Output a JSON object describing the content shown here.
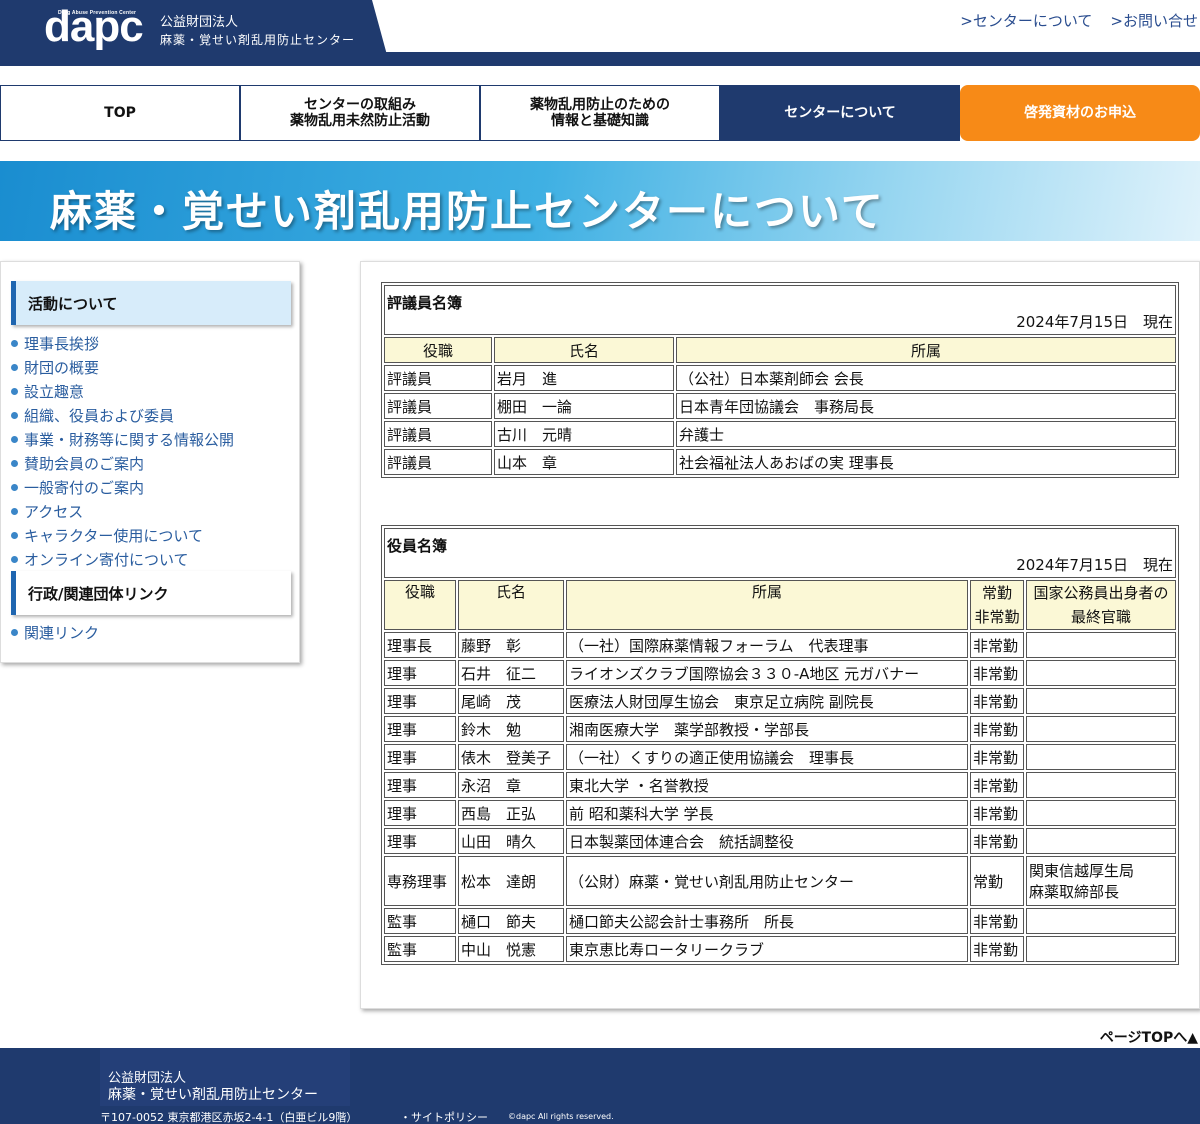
{
  "header": {
    "logo_small": "Drug Abuse Prevention Center",
    "logo_text": "dapc",
    "org_line1": "公益財団法人",
    "org_line2": "麻薬・覚せい剤乱用防止センター",
    "links": [
      ">センターについて",
      ">お問い合せ"
    ]
  },
  "nav": [
    {
      "label": "TOP"
    },
    {
      "label": "センターの取組み 薬物乱用未然防止活動"
    },
    {
      "label": "薬物乱用防止のための 情報と基礎知識"
    },
    {
      "label": "センターについて"
    },
    {
      "label": "啓発資材のお申込"
    }
  ],
  "banner": {
    "title": "麻薬・覚せい剤乱用防止センターについて"
  },
  "sidebar": {
    "section1": "活動について",
    "items": [
      "理事長挨拶",
      "財団の概要",
      "設立趣意",
      "組織、役員および委員",
      "事業・財務等に関する情報公開",
      "賛助会員のご案内",
      "一般寄付のご案内",
      "アクセス",
      "キャラクター使用について",
      "オンライン寄付について"
    ],
    "section2": "行政/関連団体リンク",
    "items2": [
      "関連リンク"
    ]
  },
  "councilors": {
    "title": "評議員名簿",
    "date": "2024年7月15日　現在",
    "headers": [
      "役職",
      "氏名",
      "所属"
    ],
    "rows": [
      [
        "評議員",
        "岩月　進",
        "（公社）日本薬剤師会 会長"
      ],
      [
        "評議員",
        "棚田　一論",
        "日本青年団協議会　事務局長"
      ],
      [
        "評議員",
        "古川　元晴",
        "弁護士"
      ],
      [
        "評議員",
        "山本　章",
        "社会福祉法人あおばの実 理事長"
      ]
    ]
  },
  "officers": {
    "title": "役員名簿",
    "date": "2024年7月15日　現在",
    "headers": [
      "役職",
      "氏名",
      "所属",
      "常勤",
      "非常勤",
      "国家公務員出身者の",
      "最終官職"
    ],
    "rows": [
      [
        "理事長",
        "藤野　彰",
        "（一社）国際麻薬情報フォーラム　代表理事",
        "非常勤",
        ""
      ],
      [
        "理事",
        "石井　征二",
        "ライオンズクラブ国際協会３３０-A地区 元ガバナー",
        "非常勤",
        ""
      ],
      [
        "理事",
        "尾崎　茂",
        "医療法人財団厚生協会　東京足立病院 副院長",
        "非常勤",
        ""
      ],
      [
        "理事",
        "鈴木　勉",
        "湘南医療大学　薬学部教授・学部長",
        "非常勤",
        ""
      ],
      [
        "理事",
        "俵木　登美子",
        "（一社）くすりの適正使用協議会　理事長",
        "非常勤",
        ""
      ],
      [
        "理事",
        "永沼　章",
        "東北大学 ・名誉教授",
        "非常勤",
        ""
      ],
      [
        "理事",
        "西島　正弘",
        "前 昭和薬科大学 学長",
        "非常勤",
        ""
      ],
      [
        "理事",
        "山田　晴久",
        "日本製薬団体連合会　統括調整役",
        "非常勤",
        ""
      ],
      [
        "専務理事",
        "松本　達朗",
        "（公財）麻薬・覚せい剤乱用防止センター",
        "常勤",
        "関東信越厚生局|麻薬取締部長"
      ],
      [
        "監事",
        "樋口　節夫",
        "樋口節夫公認会計士事務所　所長",
        "非常勤",
        ""
      ],
      [
        "監事",
        "中山　悦憲",
        "東京恵比寿ロータリークラブ",
        "非常勤",
        ""
      ]
    ]
  },
  "pagetop": "ページTOPへ▲",
  "footer": {
    "org1": "公益財団法人",
    "org2": "麻薬・覚せい剤乱用防止センター",
    "address": "〒107-0052 東京都港区赤坂2-4-1（白亜ビル9階）",
    "policy": "・サイトポリシー",
    "copyright": "©dapc All rights reserved."
  }
}
